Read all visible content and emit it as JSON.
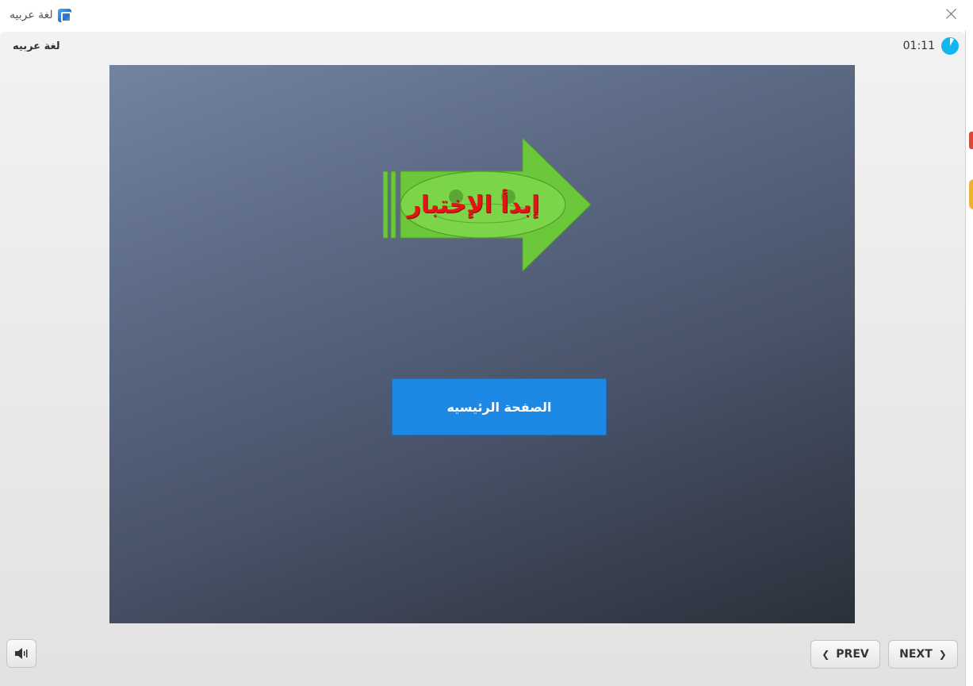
{
  "window": {
    "title": "لغة عربيه",
    "app_icon": "app-logo-icon",
    "close_icon": "close-icon"
  },
  "player": {
    "course_title": "لغة عربيه",
    "timer": "01:11",
    "timer_icon": "timer-pie-icon",
    "timer_color": "#14b6f0"
  },
  "slide": {
    "start_label": "إبدأ الإختبار",
    "start_arrow_color": "#6cc83a",
    "start_text_color": "#e51414",
    "home_label": "الصفحة الرئيسيه",
    "home_button_color": "#1e88e5"
  },
  "controls": {
    "audio_icon": "speaker-icon",
    "prev_label": "PREV",
    "next_label": "NEXT"
  }
}
